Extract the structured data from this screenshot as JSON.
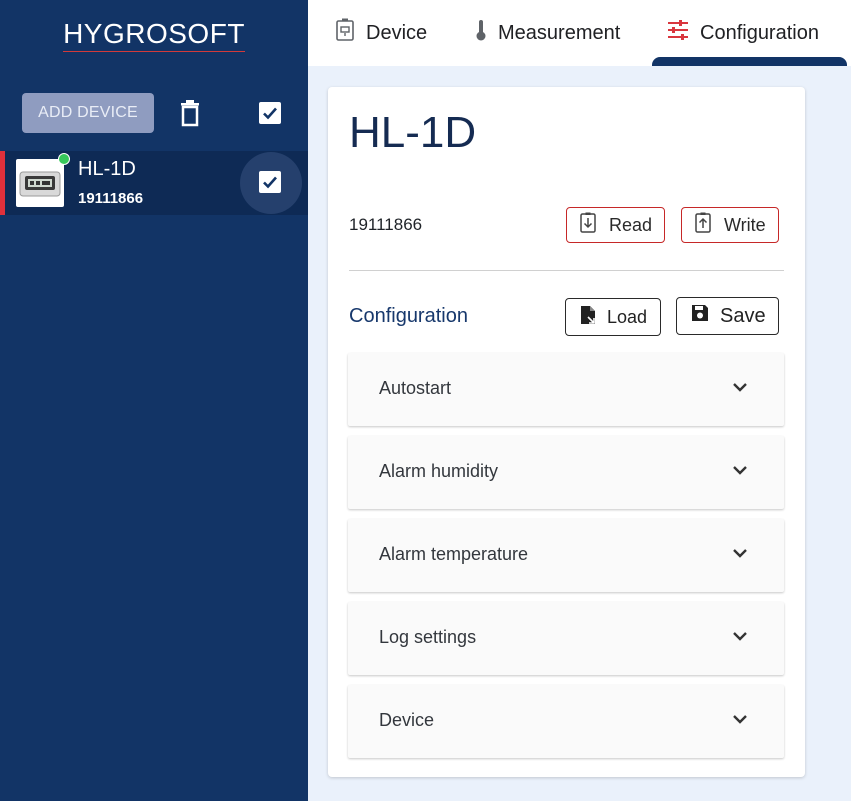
{
  "sidebar": {
    "logo": "HYGROSOFT",
    "add_device_label": "ADD DEVICE",
    "devices": [
      {
        "name": "HL-1D",
        "serial": "19111866",
        "status_color": "#37c85a"
      }
    ]
  },
  "tabs": [
    {
      "label": "Device",
      "icon": "device-icon"
    },
    {
      "label": "Measurement",
      "icon": "thermometer-icon"
    },
    {
      "label": "Configuration",
      "icon": "sliders-icon",
      "active": true
    }
  ],
  "main": {
    "title": "HL-1D",
    "serial": "19111866",
    "read_label": "Read",
    "write_label": "Write",
    "config_label": "Configuration",
    "load_label": "Load",
    "save_label": "Save",
    "sections": [
      "Autostart",
      "Alarm humidity",
      "Alarm temperature",
      "Log settings",
      "Device"
    ]
  },
  "colors": {
    "sidebar_bg": "#123466",
    "accent_red": "#c62828",
    "content_bg": "#eaf1fb"
  }
}
